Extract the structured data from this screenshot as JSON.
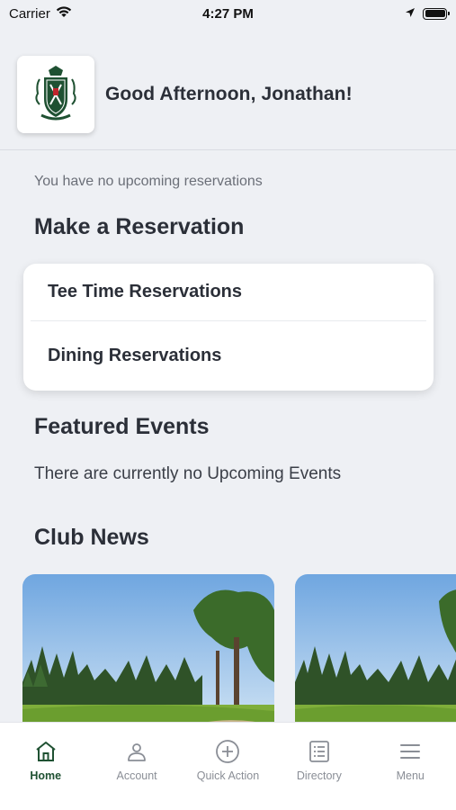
{
  "status_bar": {
    "carrier": "Carrier",
    "time": "4:27 PM"
  },
  "header": {
    "greeting": "Good Afternoon, Jonathan!",
    "logo_icon": "club-crest-logo"
  },
  "reservations": {
    "no_upcoming": "You have no upcoming reservations",
    "title": "Make a Reservation",
    "items": [
      {
        "label": "Tee Time Reservations"
      },
      {
        "label": "Dining Reservations"
      }
    ]
  },
  "events": {
    "title": "Featured Events",
    "empty_text": "There are currently no Upcoming Events"
  },
  "news": {
    "title": "Club News"
  },
  "tab_bar": {
    "tabs": [
      {
        "label": "Home",
        "icon": "home-icon",
        "active": true
      },
      {
        "label": "Account",
        "icon": "person-icon",
        "active": false
      },
      {
        "label": "Quick Action",
        "icon": "plus-circle-icon",
        "active": false
      },
      {
        "label": "Directory",
        "icon": "list-icon",
        "active": false
      },
      {
        "label": "Menu",
        "icon": "hamburger-icon",
        "active": false
      }
    ]
  },
  "colors": {
    "background": "#eef0f4",
    "accent": "#1f5132",
    "tab_inactive": "#8a8e96"
  }
}
